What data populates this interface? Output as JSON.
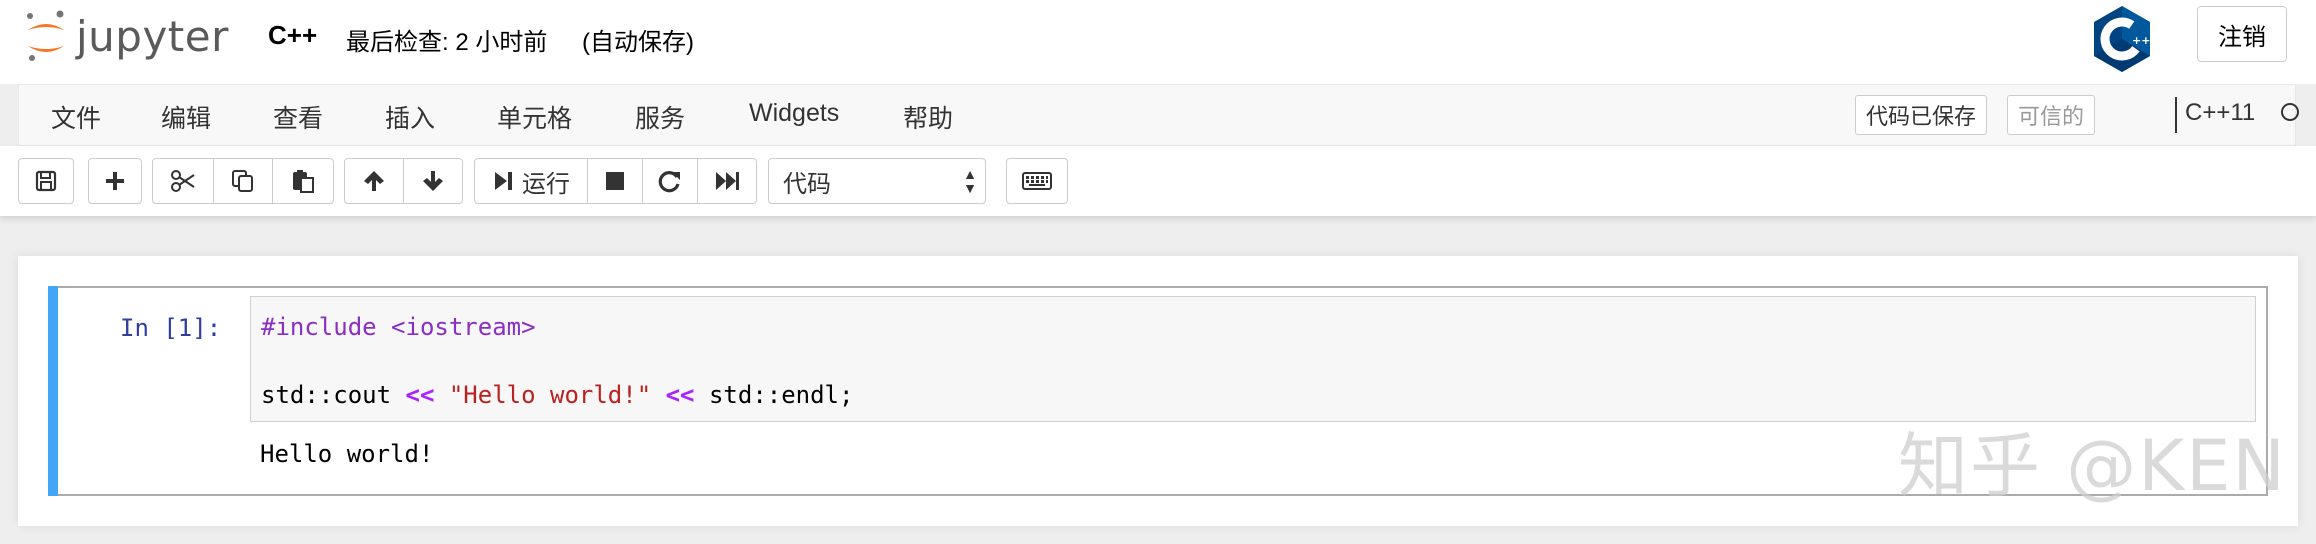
{
  "header": {
    "logo_text": "jupyter",
    "notebook_name": "C++",
    "checkpoint": "最后检查: 2 小时前",
    "autosave": "(自动保存)",
    "kernel_logo": "cpp-logo-icon",
    "logout_label": "注销"
  },
  "menubar": {
    "items": [
      "文件",
      "编辑",
      "查看",
      "插入",
      "单元格",
      "服务",
      "Widgets",
      "帮助"
    ],
    "save_state": "代码已保存",
    "trusted": "可信的",
    "kernel_name": "C++11",
    "kernel_status": "idle"
  },
  "toolbar": {
    "run_label": "运行",
    "cell_type": "代码",
    "icons": [
      "save-icon",
      "plus-icon",
      "cut-icon",
      "copy-icon",
      "paste-icon",
      "arrow-up-icon",
      "arrow-down-icon",
      "run-icon",
      "stop-icon",
      "restart-icon",
      "fast-forward-icon",
      "keyboard-icon"
    ]
  },
  "cell": {
    "prompt": "In [1]:",
    "code": {
      "line1": "#include <iostream>",
      "line2": {
        "t1": "std::cout ",
        "t2": "<<",
        "t3": " ",
        "t4": "\"Hello world!\"",
        "t5": " ",
        "t6": "<<",
        "t7": " std::endl;"
      }
    },
    "output": "Hello world!"
  },
  "watermark": "知乎 @KEN",
  "colors": {
    "accent_bar": "#42a5f5",
    "prompt": "#303f9f",
    "logo_orange": "#f37726",
    "string": "#ba2121",
    "operator": "#aa22ff"
  }
}
